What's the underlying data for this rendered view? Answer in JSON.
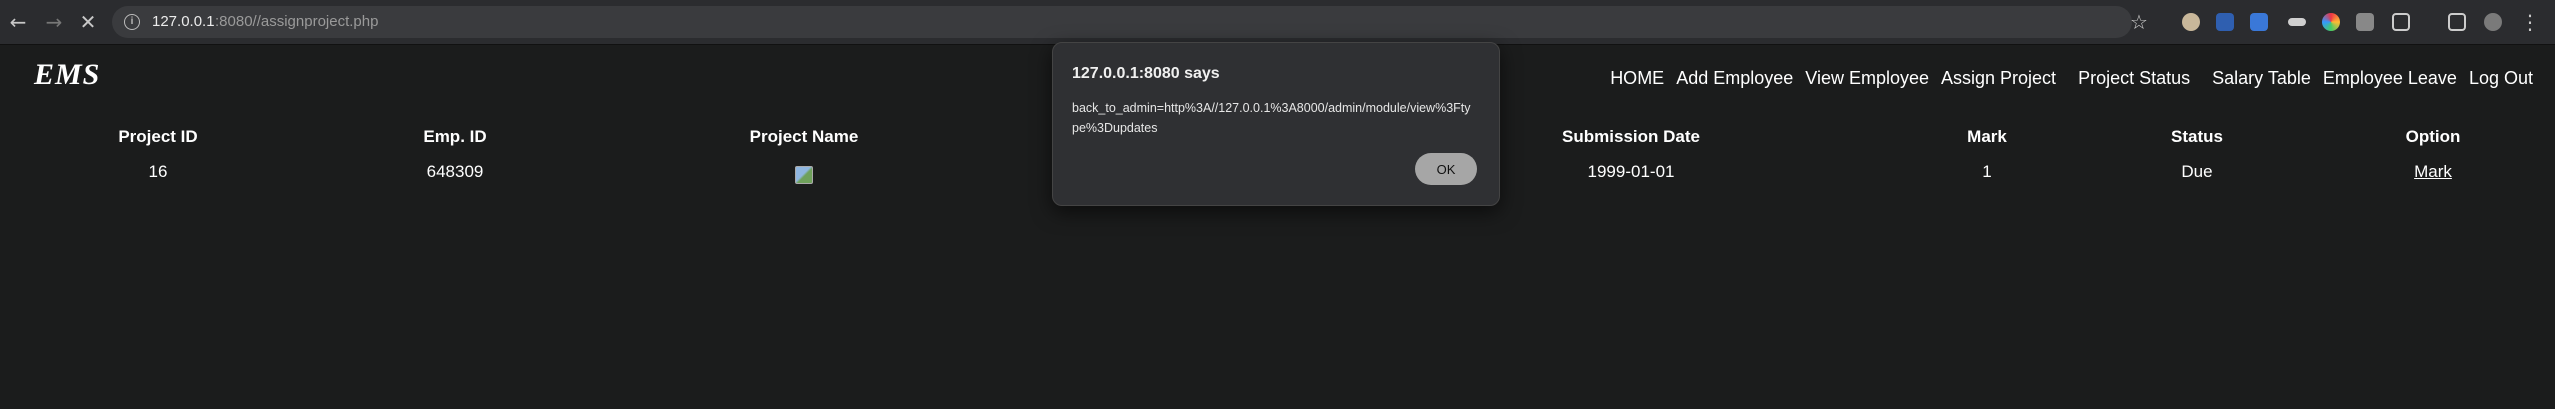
{
  "browser": {
    "url_host": "127.0.0.1",
    "url_rest": ":8080//assignproject.php",
    "icons": [
      "back-icon",
      "forward-icon",
      "close-icon",
      "info-icon",
      "star-icon"
    ]
  },
  "header": {
    "logo": "EMS",
    "nav": [
      "HOME",
      "Add Employee",
      "View Employee",
      "Assign Project",
      "Project Status",
      "Salary Table",
      "Employee Leave",
      "Log Out"
    ]
  },
  "table": {
    "headers": [
      "Project ID",
      "Emp. ID",
      "Project Name",
      "Submission Date",
      "Mark",
      "Status",
      "Option"
    ],
    "row": {
      "project_id": "16",
      "emp_id": "648309",
      "submission_date": "1999-01-01",
      "mark": "1",
      "status": "Due",
      "option": "Mark"
    }
  },
  "dialog": {
    "title": "127.0.0.1:8080 says",
    "message": "back_to_admin=http%3A//127.0.0.1%3A8000/admin/module/view%3Ftype%3Dupdates",
    "ok_label": "OK"
  },
  "colors": {
    "page_bg": "#1b1c1c",
    "chrome_bg": "#2b2c2f",
    "dialog_bg": "#2f3033",
    "ok_button": "#a6a6a6"
  }
}
